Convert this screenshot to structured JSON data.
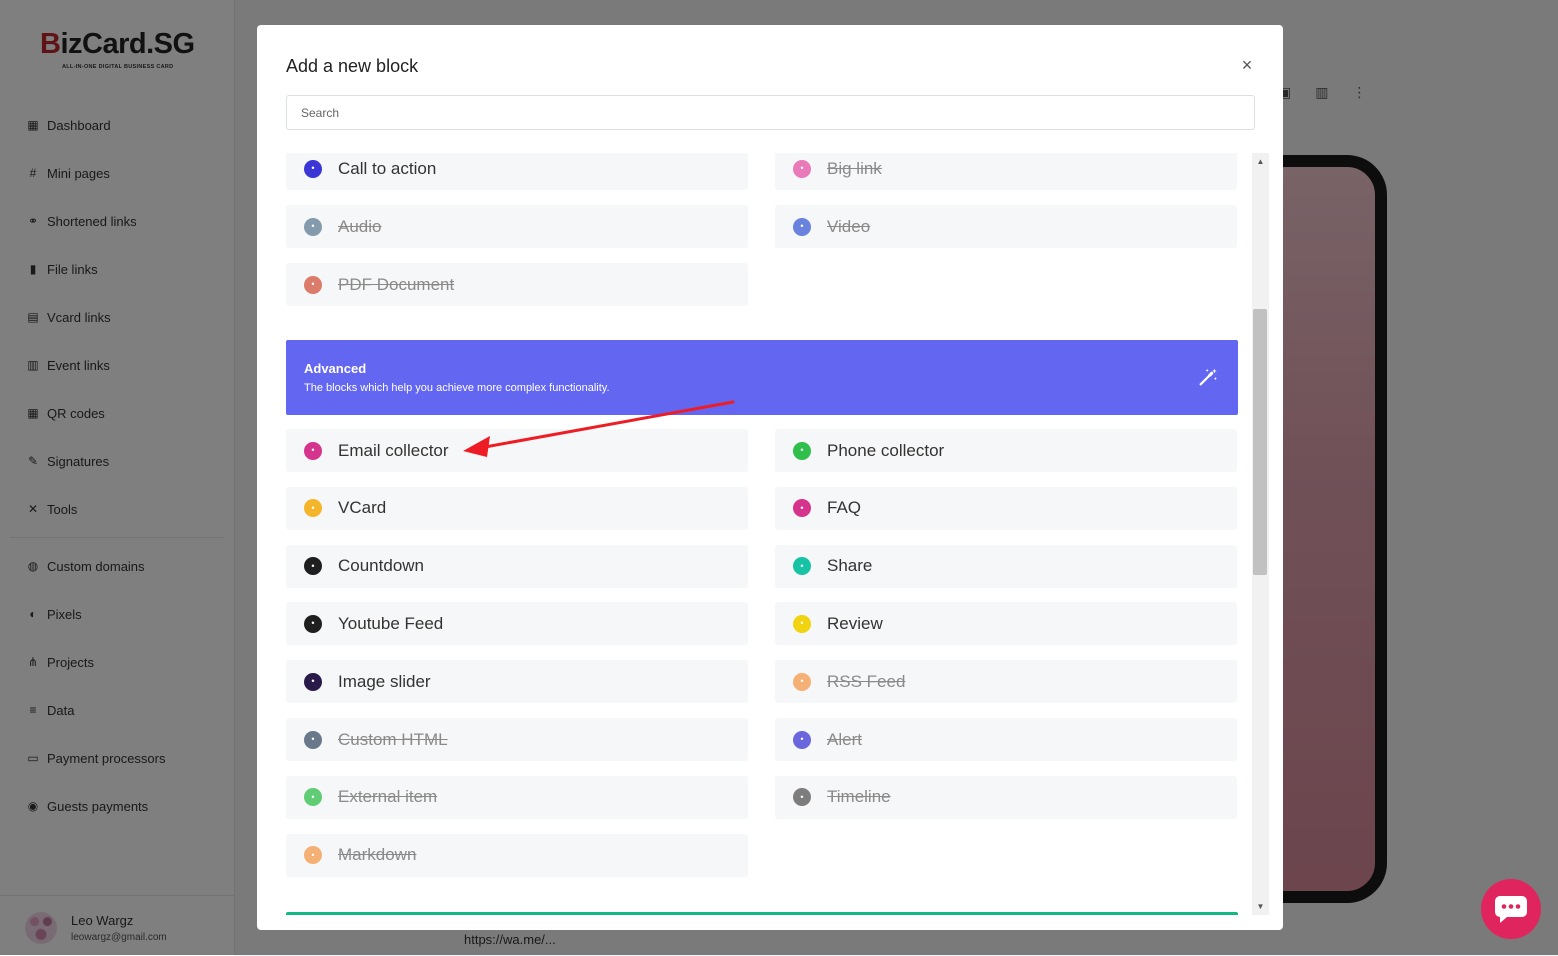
{
  "app": {
    "logo_text_b": "B",
    "logo_text_rest": "izCard.SG",
    "logo_tagline": "ALL-IN-ONE DIGITAL BUSINESS CARD",
    "brand_color": "#c0272d"
  },
  "sidebar": {
    "items": [
      {
        "label": "Dashboard",
        "icon": "grid-icon"
      },
      {
        "label": "Mini pages",
        "icon": "hash-icon"
      },
      {
        "label": "Shortened links",
        "icon": "link-icon"
      },
      {
        "label": "File links",
        "icon": "file-icon"
      },
      {
        "label": "Vcard links",
        "icon": "id-card-icon"
      },
      {
        "label": "Event links",
        "icon": "calendar-icon"
      },
      {
        "label": "QR codes",
        "icon": "qr-icon"
      },
      {
        "label": "Signatures",
        "icon": "signature-icon"
      },
      {
        "label": "Tools",
        "icon": "tools-icon"
      }
    ],
    "items2": [
      {
        "label": "Custom domains",
        "icon": "globe-icon"
      },
      {
        "label": "Pixels",
        "icon": "pixel-icon"
      },
      {
        "label": "Projects",
        "icon": "projects-icon"
      },
      {
        "label": "Data",
        "icon": "database-icon"
      },
      {
        "label": "Payment processors",
        "icon": "card-icon"
      },
      {
        "label": "Guests payments",
        "icon": "coins-icon"
      }
    ],
    "user": {
      "name": "Leo Wargz",
      "email": "leowargz@gmail.com"
    }
  },
  "background": {
    "bottom_url": "https://wa.me/..."
  },
  "modal": {
    "title": "Add a new block",
    "close_symbol": "×",
    "search_placeholder": "Search",
    "standard_blocks": [
      {
        "label": "Call to action",
        "color": "#3b36d6",
        "disabled": false,
        "col": 0,
        "row": 0
      },
      {
        "label": "Big link",
        "color": "#e64fa6",
        "disabled": true,
        "col": 1,
        "row": 0
      },
      {
        "label": "Audio",
        "color": "#5f7d95",
        "disabled": true,
        "col": 0,
        "row": 1
      },
      {
        "label": "Video",
        "color": "#3b5bd6",
        "disabled": true,
        "col": 1,
        "row": 1
      },
      {
        "label": "PDF Document",
        "color": "#d2523b",
        "disabled": true,
        "col": 0,
        "row": 2
      }
    ],
    "advanced": {
      "title": "Advanced",
      "description": "The blocks which help you achieve more complex functionality.",
      "color": "#6366f1"
    },
    "advanced_blocks": [
      {
        "label": "Email collector",
        "color": "#d6338d",
        "disabled": false
      },
      {
        "label": "Phone collector",
        "color": "#2fbf4a",
        "disabled": false
      },
      {
        "label": "VCard",
        "color": "#f5b52b",
        "disabled": false
      },
      {
        "label": "FAQ",
        "color": "#d6338d",
        "disabled": false
      },
      {
        "label": "Countdown",
        "color": "#1f1f1f",
        "disabled": false
      },
      {
        "label": "Share",
        "color": "#17c3a5",
        "disabled": false
      },
      {
        "label": "Youtube Feed",
        "color": "#1f1f1f",
        "disabled": false
      },
      {
        "label": "Review",
        "color": "#f2d30f",
        "disabled": false
      },
      {
        "label": "Image slider",
        "color": "#2a1a4a",
        "disabled": false
      },
      {
        "label": "RSS Feed",
        "color": "#f59a4a",
        "disabled": true
      },
      {
        "label": "Custom HTML",
        "color": "#3a4e66",
        "disabled": true
      },
      {
        "label": "Alert",
        "color": "#3b36d6",
        "disabled": true
      },
      {
        "label": "External item",
        "color": "#2fbf4a",
        "disabled": true
      },
      {
        "label": "Timeline",
        "color": "#555555",
        "disabled": true
      },
      {
        "label": "Markdown",
        "color": "#f59a4a",
        "disabled": true
      }
    ],
    "next_banner_color": "#10b981"
  },
  "annotation": {
    "arrow_color": "#ee1c25"
  },
  "chat": {
    "color": "#e0245e",
    "icon": "chat-bubble-icon"
  }
}
